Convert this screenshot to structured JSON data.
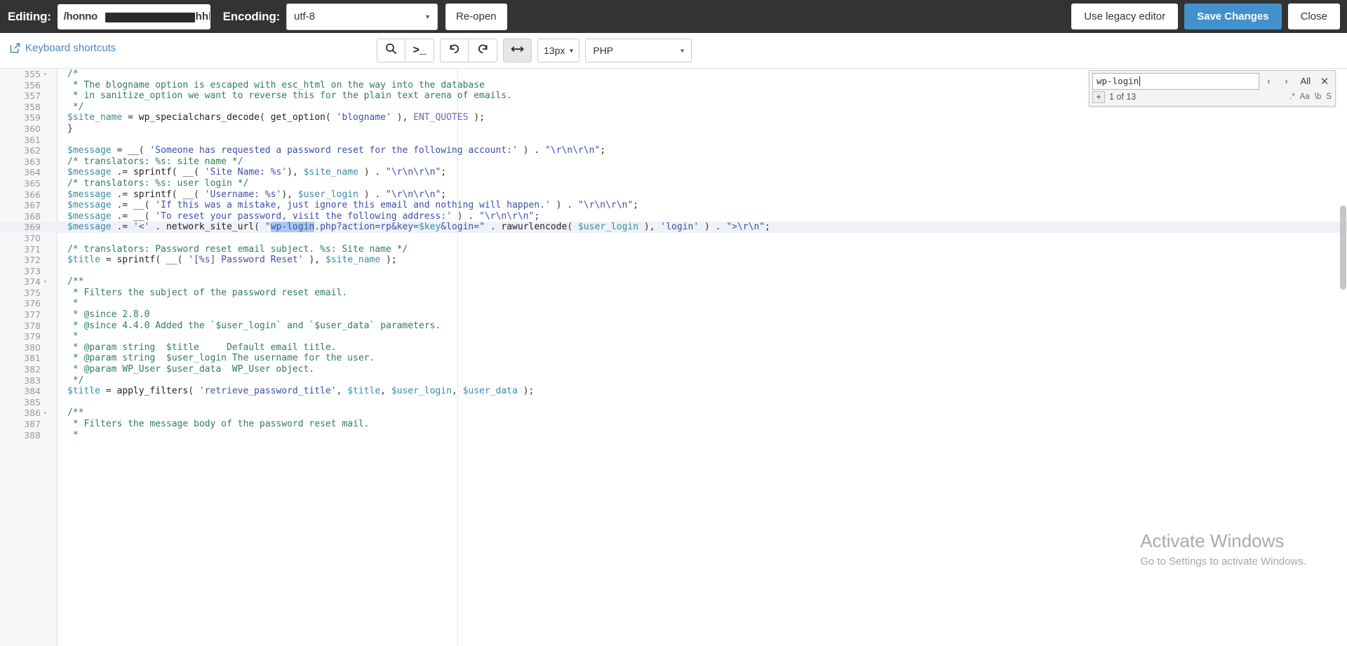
{
  "topbar": {
    "editing_label": "Editing:",
    "file_path": "/honno",
    "file_path_tail": "hhbblic_",
    "encoding_label": "Encoding:",
    "encoding_value": "utf-8",
    "reopen_label": "Re-open",
    "legacy_editor_label": "Use legacy editor",
    "save_label": "Save Changes",
    "close_label": "Close",
    "primary_color": "#4391cb",
    "bar_color": "#333333"
  },
  "toolbar": {
    "keyboard_shortcuts_label": "Keyboard shortcuts",
    "link_color": "#4a88b5",
    "buttons": [
      {
        "name": "search-icon",
        "glyph": "search",
        "title": "Search"
      },
      {
        "name": "console-icon",
        "glyph": ">_",
        "title": "Console"
      },
      {
        "name": "undo-icon",
        "glyph": "undo",
        "title": "Undo"
      },
      {
        "name": "redo-icon",
        "glyph": "redo",
        "title": "Redo"
      },
      {
        "name": "word-wrap-icon",
        "glyph": "arrows-h",
        "title": "Toggle word wrap",
        "active": true
      }
    ],
    "font_size_value": "13px",
    "language_value": "PHP"
  },
  "find": {
    "query": "wp-login",
    "prev_label": "‹",
    "next_label": "›",
    "all_label": "All",
    "close_label": "✕",
    "expand_label": "+",
    "count_label": "1 of 13",
    "toggles": [
      ".*",
      "Aa",
      "\\b",
      "S"
    ]
  },
  "watermark": {
    "title": "Activate Windows",
    "subtitle": "Go to Settings to activate Windows."
  },
  "editor": {
    "gutter_bg": "#f7f7f7",
    "highlight_line": 369,
    "lines": [
      {
        "num": 355,
        "fold": true,
        "html": "<span class=\"k-com\">/*</span>"
      },
      {
        "num": 356,
        "fold": false,
        "html": "<span class=\"k-com\"> * The blogname option is escaped with esc_html on the way into the database</span>"
      },
      {
        "num": 357,
        "fold": false,
        "html": "<span class=\"k-com\"> * in sanitize_option we want to reverse this for the plain text arena of emails.</span>"
      },
      {
        "num": 358,
        "fold": false,
        "html": "<span class=\"k-com\"> */</span>"
      },
      {
        "num": 359,
        "fold": false,
        "html": "<span class=\"k-var\">$site_name</span> <span class=\"k-op\">=</span> <span class=\"k-fn\">wp_specialchars_decode</span><span class=\"k-punc\">(</span> <span class=\"k-fn\">get_option</span><span class=\"k-punc\">(</span> <span class=\"k-str\">'blogname'</span> <span class=\"k-punc\">)</span>, <span class=\"k-const\">ENT_QUOTES</span> <span class=\"k-punc\">);</span>"
      },
      {
        "num": 360,
        "fold": false,
        "html": "<span class=\"k-punc\">}</span>"
      },
      {
        "num": 361,
        "fold": false,
        "html": ""
      },
      {
        "num": 362,
        "fold": false,
        "html": "<span class=\"k-var\">$message</span> <span class=\"k-op\">=</span> <span class=\"k-fn\">__</span><span class=\"k-punc\">(</span> <span class=\"k-str\">'Someone has requested a password reset for the following account:'</span> <span class=\"k-punc\">)</span> . <span class=\"k-str\">\"<span class=\"k-num\">\\r\\n\\r\\n</span>\"</span><span class=\"k-punc\">;</span>"
      },
      {
        "num": 363,
        "fold": false,
        "html": "<span class=\"k-com\">/* translators: %s: site name */</span>"
      },
      {
        "num": 364,
        "fold": false,
        "html": "<span class=\"k-var\">$message</span> <span class=\"k-op\">.=</span> <span class=\"k-fn\">sprintf</span><span class=\"k-punc\">(</span> <span class=\"k-fn\">__</span><span class=\"k-punc\">(</span> <span class=\"k-str\">'Site Name: %s'</span><span class=\"k-punc\">)</span>, <span class=\"k-var\">$site_name</span> <span class=\"k-punc\">)</span> . <span class=\"k-str\">\"\\r\\n\\r\\n\"</span><span class=\"k-punc\">;</span>"
      },
      {
        "num": 365,
        "fold": false,
        "html": "<span class=\"k-com\">/* translators: %s: user login */</span>"
      },
      {
        "num": 366,
        "fold": false,
        "html": "<span class=\"k-var\">$message</span> <span class=\"k-op\">.=</span> <span class=\"k-fn\">sprintf</span><span class=\"k-punc\">(</span> <span class=\"k-fn\">__</span><span class=\"k-punc\">(</span> <span class=\"k-str\">'Username: %s'</span><span class=\"k-punc\">)</span>, <span class=\"k-var\">$user_login</span> <span class=\"k-punc\">)</span> . <span class=\"k-str\">\"\\r\\n\\r\\n\"</span><span class=\"k-punc\">;</span>"
      },
      {
        "num": 367,
        "fold": false,
        "html": "<span class=\"k-var\">$message</span> <span class=\"k-op\">.=</span> <span class=\"k-fn\">__</span><span class=\"k-punc\">(</span> <span class=\"k-str\">'If this was a mistake, just ignore this email and nothing will happen.'</span> <span class=\"k-punc\">)</span> . <span class=\"k-str\">\"\\r\\n\\r\\n\"</span><span class=\"k-punc\">;</span>"
      },
      {
        "num": 368,
        "fold": false,
        "html": "<span class=\"k-var\">$message</span> <span class=\"k-op\">.=</span> <span class=\"k-fn\">__</span><span class=\"k-punc\">(</span> <span class=\"k-str\">'To reset your password, visit the following address:'</span> <span class=\"k-punc\">)</span> . <span class=\"k-str\">\"\\r\\n\\r\\n\"</span><span class=\"k-punc\">;</span>"
      },
      {
        "num": 369,
        "fold": false,
        "html": "<span class=\"k-var\">$message</span> <span class=\"k-op\">.=</span> <span class=\"k-str\">'&lt;'</span> . <span class=\"k-fn\">network_site_url</span><span class=\"k-punc\">(</span> <span class=\"k-str\">\"<span class=\"match-sel\">wp-login</span>.php?action=rp&amp;key=</span><span class=\"k-var\">$key</span><span class=\"k-str\">&amp;login=\"</span> . <span class=\"k-fn\">rawurlencode</span><span class=\"k-punc\">(</span> <span class=\"k-var\">$user_login</span> <span class=\"k-punc\">)</span>, <span class=\"k-str\">'login'</span> <span class=\"k-punc\">)</span> . <span class=\"k-str\">\"&gt;\\r\\n\"</span><span class=\"k-punc\">;</span>"
      },
      {
        "num": 370,
        "fold": false,
        "html": ""
      },
      {
        "num": 371,
        "fold": false,
        "html": "<span class=\"k-com\">/* translators: Password reset email subject. %s: Site name */</span>"
      },
      {
        "num": 372,
        "fold": false,
        "html": "<span class=\"k-var\">$title</span> <span class=\"k-op\">=</span> <span class=\"k-fn\">sprintf</span><span class=\"k-punc\">(</span> <span class=\"k-fn\">__</span><span class=\"k-punc\">(</span> <span class=\"k-str\">'[%s] Password Reset'</span> <span class=\"k-punc\">)</span>, <span class=\"k-var\">$site_name</span> <span class=\"k-punc\">);</span>"
      },
      {
        "num": 373,
        "fold": false,
        "html": ""
      },
      {
        "num": 374,
        "fold": true,
        "html": "<span class=\"k-com\">/**</span>"
      },
      {
        "num": 375,
        "fold": false,
        "html": "<span class=\"k-com\"> * Filters the subject of the password reset email.</span>"
      },
      {
        "num": 376,
        "fold": false,
        "html": "<span class=\"k-com\"> *</span>"
      },
      {
        "num": 377,
        "fold": false,
        "html": "<span class=\"k-com\"> * @since 2.8.0</span>"
      },
      {
        "num": 378,
        "fold": false,
        "html": "<span class=\"k-com\"> * @since 4.4.0 Added the `$user_login` and `$user_data` parameters.</span>"
      },
      {
        "num": 379,
        "fold": false,
        "html": "<span class=\"k-com\"> *</span>"
      },
      {
        "num": 380,
        "fold": false,
        "html": "<span class=\"k-com\"> * @param string  $title     Default email title.</span>"
      },
      {
        "num": 381,
        "fold": false,
        "html": "<span class=\"k-com\"> * @param string  $user_login The username for the user.</span>"
      },
      {
        "num": 382,
        "fold": false,
        "html": "<span class=\"k-com\"> * @param WP_User $user_data  WP_User object.</span>"
      },
      {
        "num": 383,
        "fold": false,
        "html": "<span class=\"k-com\"> */</span>"
      },
      {
        "num": 384,
        "fold": false,
        "html": "<span class=\"k-var\">$title</span> <span class=\"k-op\">=</span> <span class=\"k-fn\">apply_filters</span><span class=\"k-punc\">(</span> <span class=\"k-str\">'retrieve_password_title'</span>, <span class=\"k-var\">$title</span>, <span class=\"k-var\">$user_login</span>, <span class=\"k-var\">$user_data</span> <span class=\"k-punc\">);</span>"
      },
      {
        "num": 385,
        "fold": false,
        "html": ""
      },
      {
        "num": 386,
        "fold": true,
        "html": "<span class=\"k-com\">/**</span>"
      },
      {
        "num": 387,
        "fold": false,
        "html": "<span class=\"k-com\"> * Filters the message body of the password reset mail.</span>"
      },
      {
        "num": 388,
        "fold": false,
        "html": "<span class=\"k-com\"> *</span>"
      }
    ]
  }
}
